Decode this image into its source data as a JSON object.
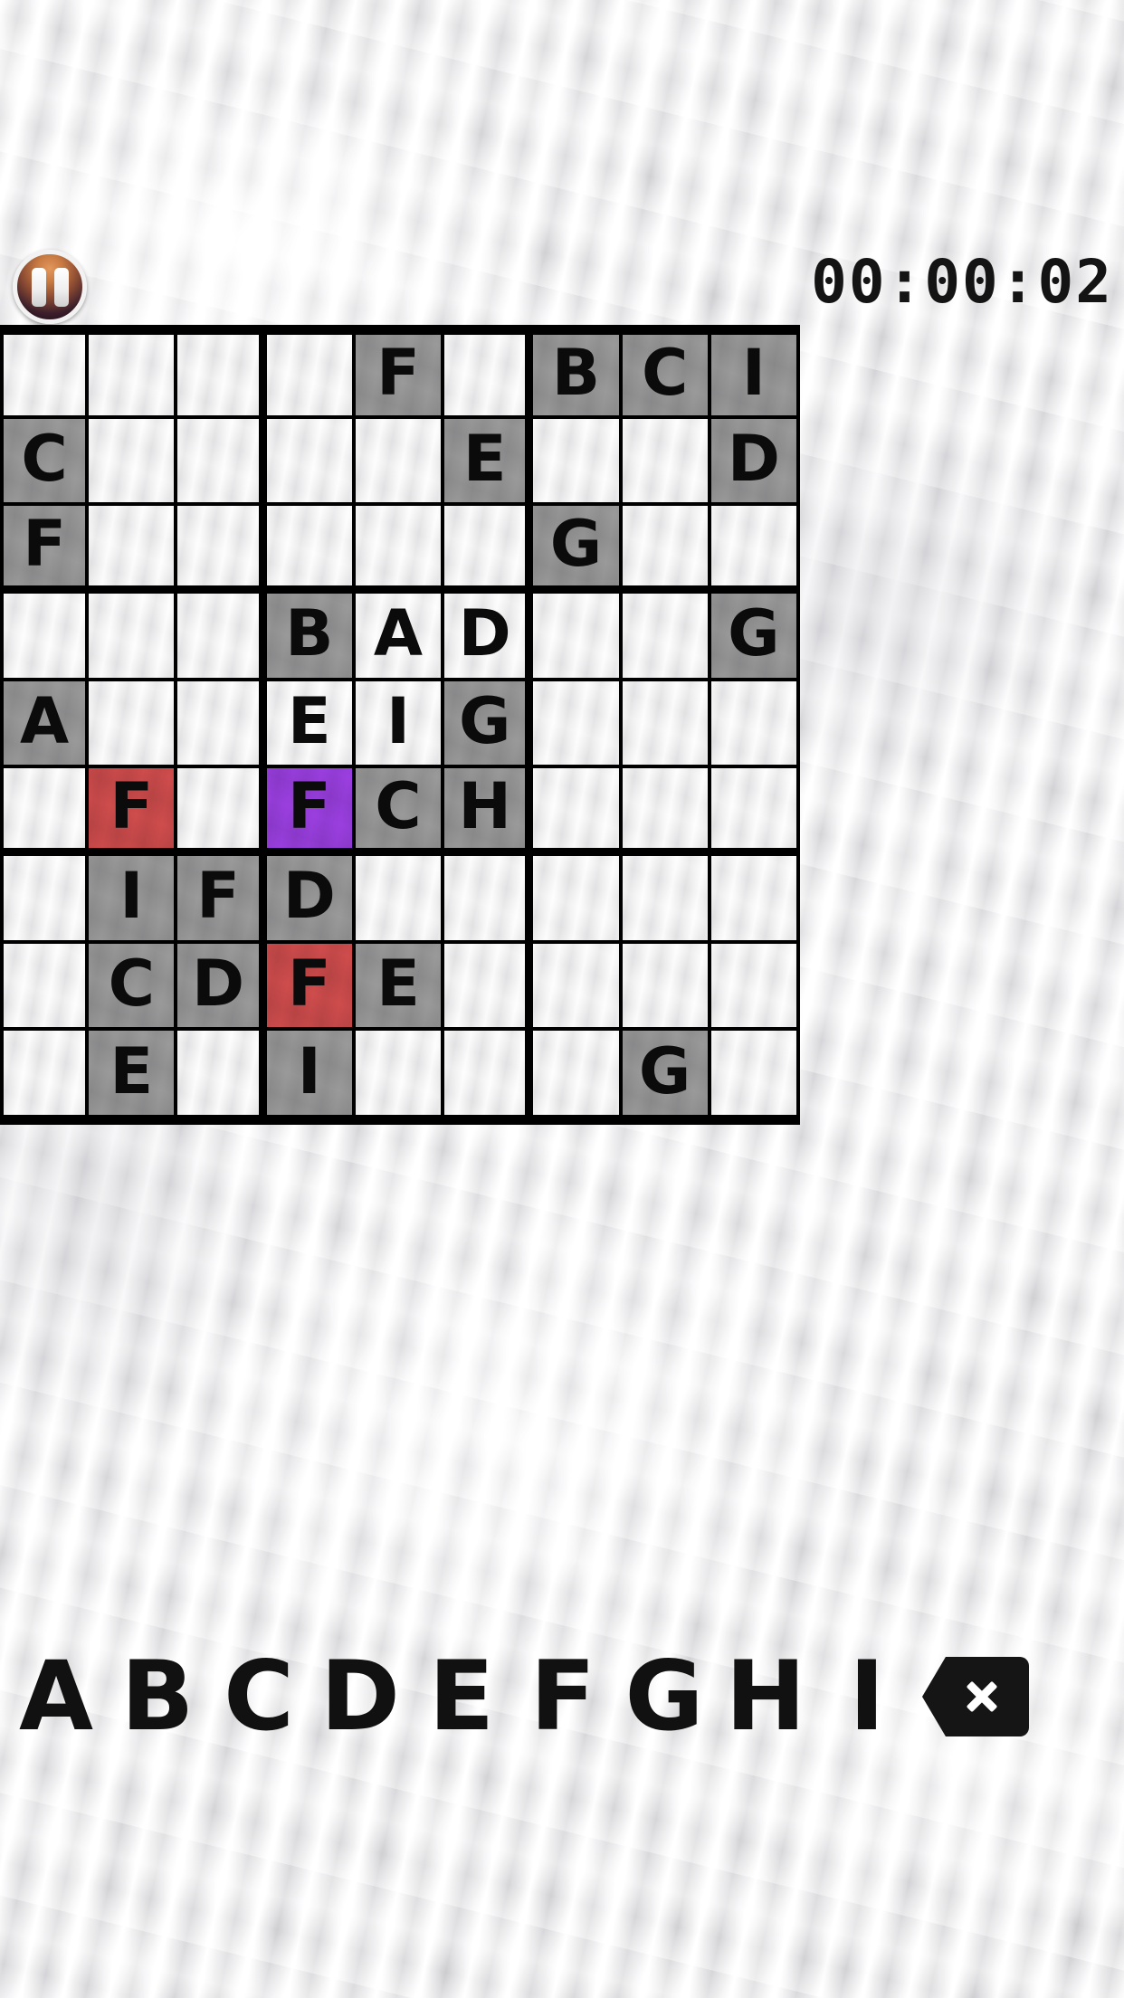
{
  "app": {
    "title": "Letter Sudoku",
    "background": "crumpled-paper"
  },
  "toolbar": {
    "pause_label": "Pause",
    "pause_icon": "pause-icon",
    "timer": "00:00:02",
    "timer_format": "HH:MM:SS"
  },
  "colors": {
    "given_cell": "#9a9a9a",
    "empty_cell": "#f4f4f4",
    "error_cell": "#cf4c4c",
    "selected_cell": "#9b3fe0",
    "grid_line": "#000000",
    "text": "#0b0b0b",
    "pause_accent": "#c77a42"
  },
  "board": {
    "size": 9,
    "block": 3,
    "legend": {
      "given": "gray",
      "error": "red",
      "selected": "purple",
      "empty": "none"
    },
    "rows": [
      [
        {
          "v": "",
          "s": "none"
        },
        {
          "v": "",
          "s": "none"
        },
        {
          "v": "",
          "s": "none"
        },
        {
          "v": "",
          "s": "none"
        },
        {
          "v": "F",
          "s": "gray"
        },
        {
          "v": "",
          "s": "none"
        },
        {
          "v": "B",
          "s": "gray"
        },
        {
          "v": "C",
          "s": "gray"
        },
        {
          "v": "I",
          "s": "gray"
        }
      ],
      [
        {
          "v": "C",
          "s": "gray"
        },
        {
          "v": "",
          "s": "none"
        },
        {
          "v": "",
          "s": "none"
        },
        {
          "v": "",
          "s": "none"
        },
        {
          "v": "",
          "s": "none"
        },
        {
          "v": "E",
          "s": "gray"
        },
        {
          "v": "",
          "s": "none"
        },
        {
          "v": "",
          "s": "none"
        },
        {
          "v": "D",
          "s": "gray"
        }
      ],
      [
        {
          "v": "F",
          "s": "gray"
        },
        {
          "v": "",
          "s": "none"
        },
        {
          "v": "",
          "s": "none"
        },
        {
          "v": "",
          "s": "none"
        },
        {
          "v": "",
          "s": "none"
        },
        {
          "v": "",
          "s": "none"
        },
        {
          "v": "G",
          "s": "gray"
        },
        {
          "v": "",
          "s": "none"
        },
        {
          "v": "",
          "s": "none"
        }
      ],
      [
        {
          "v": "",
          "s": "none"
        },
        {
          "v": "",
          "s": "none"
        },
        {
          "v": "",
          "s": "none"
        },
        {
          "v": "B",
          "s": "gray"
        },
        {
          "v": "A",
          "s": "none"
        },
        {
          "v": "D",
          "s": "none"
        },
        {
          "v": "",
          "s": "none"
        },
        {
          "v": "",
          "s": "none"
        },
        {
          "v": "G",
          "s": "gray"
        }
      ],
      [
        {
          "v": "A",
          "s": "gray"
        },
        {
          "v": "",
          "s": "none"
        },
        {
          "v": "",
          "s": "none"
        },
        {
          "v": "E",
          "s": "none"
        },
        {
          "v": "I",
          "s": "none"
        },
        {
          "v": "G",
          "s": "gray"
        },
        {
          "v": "",
          "s": "none"
        },
        {
          "v": "",
          "s": "none"
        },
        {
          "v": "",
          "s": "none"
        }
      ],
      [
        {
          "v": "",
          "s": "none"
        },
        {
          "v": "F",
          "s": "red"
        },
        {
          "v": "",
          "s": "none"
        },
        {
          "v": "F",
          "s": "purple"
        },
        {
          "v": "C",
          "s": "gray"
        },
        {
          "v": "H",
          "s": "gray"
        },
        {
          "v": "",
          "s": "none"
        },
        {
          "v": "",
          "s": "none"
        },
        {
          "v": "",
          "s": "none"
        }
      ],
      [
        {
          "v": "",
          "s": "none"
        },
        {
          "v": "I",
          "s": "gray"
        },
        {
          "v": "F",
          "s": "gray"
        },
        {
          "v": "D",
          "s": "gray"
        },
        {
          "v": "",
          "s": "none"
        },
        {
          "v": "",
          "s": "none"
        },
        {
          "v": "",
          "s": "none"
        },
        {
          "v": "",
          "s": "none"
        },
        {
          "v": "",
          "s": "none"
        }
      ],
      [
        {
          "v": "",
          "s": "none"
        },
        {
          "v": "C",
          "s": "gray"
        },
        {
          "v": "D",
          "s": "gray"
        },
        {
          "v": "F",
          "s": "red"
        },
        {
          "v": "E",
          "s": "gray"
        },
        {
          "v": "",
          "s": "none"
        },
        {
          "v": "",
          "s": "none"
        },
        {
          "v": "",
          "s": "none"
        },
        {
          "v": "",
          "s": "none"
        }
      ],
      [
        {
          "v": "",
          "s": "none"
        },
        {
          "v": "E",
          "s": "gray"
        },
        {
          "v": "",
          "s": "none"
        },
        {
          "v": "I",
          "s": "gray"
        },
        {
          "v": "",
          "s": "none"
        },
        {
          "v": "",
          "s": "none"
        },
        {
          "v": "",
          "s": "none"
        },
        {
          "v": "G",
          "s": "gray"
        },
        {
          "v": "",
          "s": "none"
        }
      ]
    ]
  },
  "keypad": {
    "keys": [
      "A",
      "B",
      "C",
      "D",
      "E",
      "F",
      "G",
      "H",
      "I"
    ],
    "erase_label": "",
    "erase_icon": "erase-x-icon"
  }
}
